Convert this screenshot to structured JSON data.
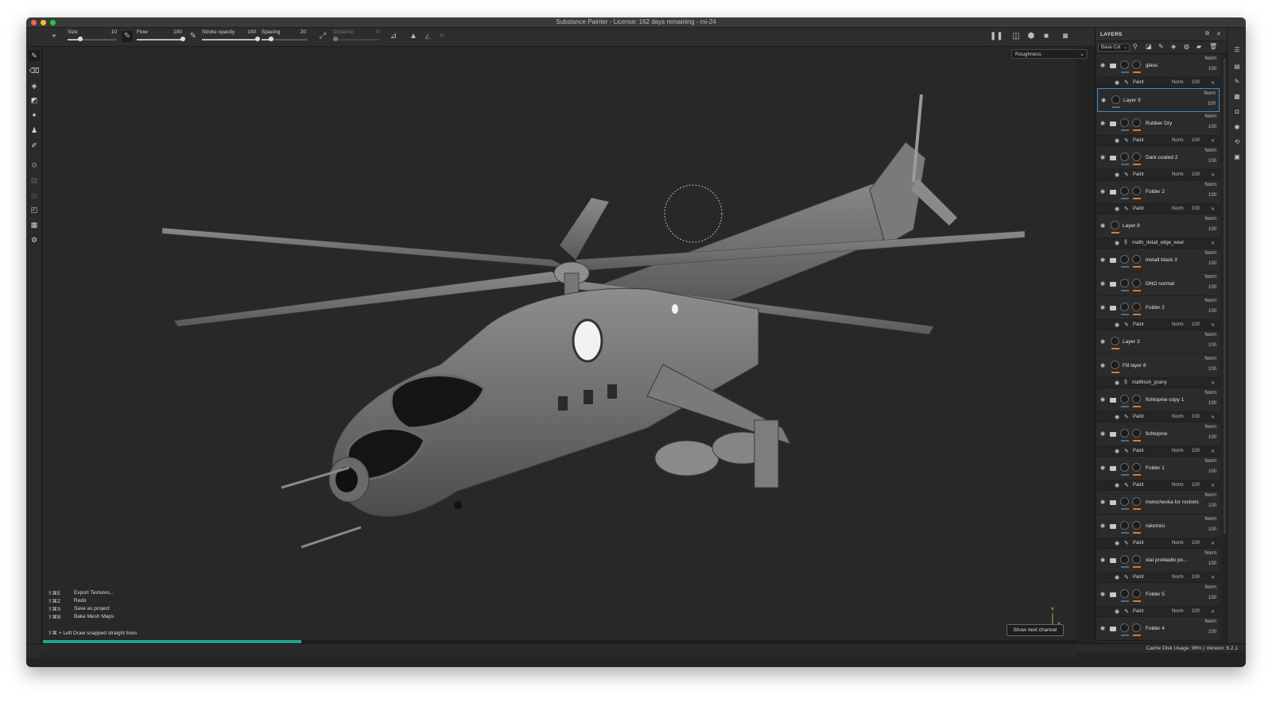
{
  "window": {
    "title": "Substance Painter - License: 162 days remaining - mi-24"
  },
  "toolbar": {
    "size_label": "Size",
    "size_value": "10",
    "flow_label": "Flow",
    "flow_value": "100",
    "stroke_opacity_label": "Stroke opacity",
    "stroke_opacity_value": "100",
    "spacing_label": "Spacing",
    "spacing_value": "20",
    "distance_label": "Distance",
    "distance_value": "0",
    "sliders": {
      "size": 0.26,
      "flow": 1.0,
      "stroke_opacity": 1.0,
      "spacing": 0.2,
      "distance": 0.0
    }
  },
  "viewport": {
    "channel": "Roughness",
    "show_next_channel": "Show next channel",
    "axis_y": "Y",
    "axis_x": "X",
    "progress": 0.25,
    "shortcuts": [
      {
        "keys": "⇧⌘E",
        "label": "Export Textures..."
      },
      {
        "keys": "⇧⌘Z",
        "label": "Redo"
      },
      {
        "keys": "⇧⌘S",
        "label": "Save as project"
      },
      {
        "keys": "⇧⌘B",
        "label": "Bake Mesh Maps"
      }
    ],
    "hint": "⇧⌘ + Left  Draw snapped straight lines"
  },
  "layers": {
    "title": "LAYERS",
    "channel_select": "Base Col",
    "items": [
      {
        "name": "glass",
        "folder": true,
        "mode": "Norm",
        "opacity": "100",
        "sub": "paint"
      },
      {
        "name": "Layer 9",
        "folder": false,
        "mode": "Norm",
        "opacity": "100",
        "selected": true
      },
      {
        "name": "Rubber Dry",
        "folder": true,
        "mode": "Norm",
        "opacity": "100",
        "sub": "paint"
      },
      {
        "name": "Dark coated 2",
        "folder": true,
        "mode": "Norm",
        "opacity": "100",
        "sub": "paint"
      },
      {
        "name": "Folder 2",
        "folder": true,
        "mode": "Norm",
        "opacity": "100",
        "sub": "paint"
      },
      {
        "name": "Layer 8",
        "folder": false,
        "mode": "Norm",
        "opacity": "100",
        "sub": "fx",
        "fx": "matfx_detail_edge_wear"
      },
      {
        "name": "metall black 3",
        "folder": true,
        "mode": "Norm",
        "opacity": "100"
      },
      {
        "name": "DNO normal",
        "folder": true,
        "mode": "Norm",
        "opacity": "100"
      },
      {
        "name": "Folder 2",
        "folder": true,
        "mode": "Norm",
        "opacity": "100",
        "sub": "paint"
      },
      {
        "name": "Layer 3",
        "folder": false,
        "mode": "Norm",
        "opacity": "100"
      },
      {
        "name": "Fill layer 8",
        "folder": false,
        "mode": "Norm",
        "opacity": "100",
        "sub": "fx",
        "fx": "matfinish_grainy"
      },
      {
        "name": "fichlopnie copy 1",
        "folder": true,
        "mode": "Norm",
        "opacity": "100",
        "sub": "paint"
      },
      {
        "name": "fichlopnie",
        "folder": true,
        "mode": "Norm",
        "opacity": "100",
        "sub": "paint"
      },
      {
        "name": "Folder 1",
        "folder": true,
        "mode": "Norm",
        "opacity": "100",
        "sub": "paint"
      },
      {
        "name": "melochevka for rockets",
        "folder": true,
        "mode": "Norm",
        "opacity": "100"
      },
      {
        "name": "raketnici",
        "folder": true,
        "mode": "Norm",
        "opacity": "100",
        "sub": "paint"
      },
      {
        "name": "stal prokladki po...",
        "folder": true,
        "mode": "Norm",
        "opacity": "100",
        "sub": "paint"
      },
      {
        "name": "Folder 5",
        "folder": true,
        "mode": "Norm",
        "opacity": "100",
        "sub": "paint"
      },
      {
        "name": "Folder 4",
        "folder": true,
        "mode": "Norm",
        "opacity": "100"
      }
    ],
    "sub_paint": {
      "name": "Paint",
      "mode": "Norm",
      "opacity": "100"
    }
  },
  "status": {
    "text": "Cache Disk Usage:    96% | Version: 6.2.1"
  },
  "colors": {
    "accent": "#e07b26",
    "progress": "#1fa58c",
    "selection": "#3a8bd6"
  }
}
